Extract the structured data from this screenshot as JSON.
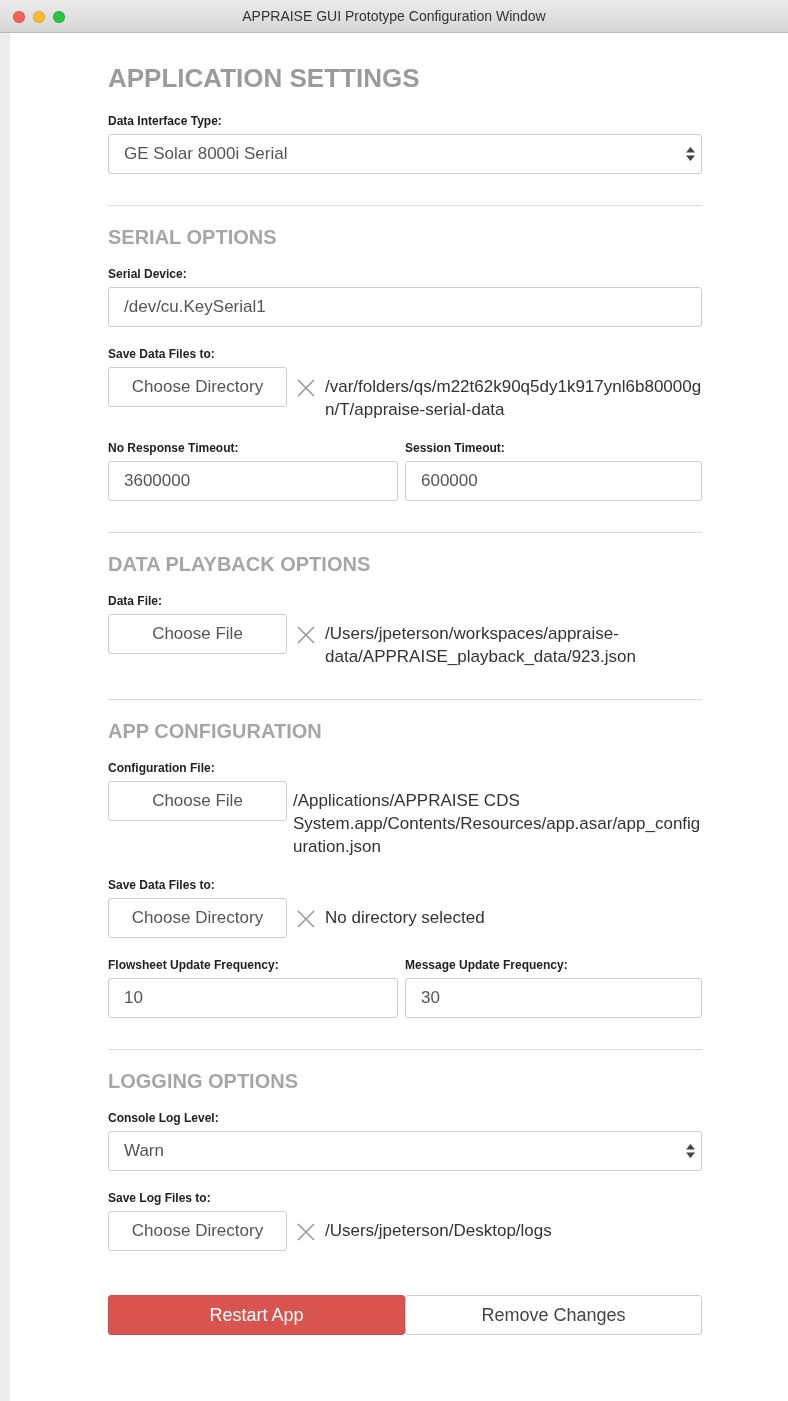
{
  "window": {
    "title": "APPRAISE GUI Prototype Configuration Window"
  },
  "heading": "APPLICATION SETTINGS",
  "sections": [
    {
      "fields": [
        {
          "kind": "select",
          "label": "Data Interface Type:",
          "value": "GE Solar 8000i Serial"
        }
      ]
    },
    {
      "title": "SERIAL OPTIONS",
      "fields": [
        {
          "kind": "text",
          "label": "Serial Device:",
          "value": "/dev/cu.KeySerial1"
        },
        {
          "kind": "file",
          "label": "Save Data Files to:",
          "button": "Choose Directory",
          "clearable": true,
          "path": "/var/folders/qs/m22t62k90q5dy1k917ynl6b80000gn/T/appraise-serial-data"
        },
        {
          "kind": "pair",
          "items": [
            {
              "label": "No Response Timeout:",
              "value": "3600000"
            },
            {
              "label": "Session Timeout:",
              "value": "600000"
            }
          ]
        }
      ]
    },
    {
      "title": "DATA PLAYBACK OPTIONS",
      "fields": [
        {
          "kind": "file",
          "label": "Data File:",
          "button": "Choose File",
          "clearable": true,
          "path": "/Users/jpeterson/workspaces/appraise-data/APPRAISE_playback_data/923.json"
        }
      ]
    },
    {
      "title": "APP CONFIGURATION",
      "fields": [
        {
          "kind": "file",
          "label": "Configuration File:",
          "button": "Choose File",
          "clearable": false,
          "path": "/Applications/APPRAISE CDS System.app/Contents/Resources/app.asar/app_configuration.json"
        },
        {
          "kind": "file",
          "label": "Save Data Files to:",
          "button": "Choose Directory",
          "clearable": true,
          "path": "No directory selected"
        },
        {
          "kind": "pair",
          "items": [
            {
              "label": "Flowsheet Update Frequency:",
              "value": "10"
            },
            {
              "label": "Message Update Frequency:",
              "value": "30"
            }
          ]
        }
      ]
    },
    {
      "title": "LOGGING OPTIONS",
      "fields": [
        {
          "kind": "select",
          "label": "Console Log Level:",
          "value": "Warn"
        },
        {
          "kind": "file",
          "label": "Save Log Files to:",
          "button": "Choose Directory",
          "clearable": true,
          "path": "/Users/jpeterson/Desktop/logs"
        }
      ]
    }
  ],
  "buttons": [
    {
      "kind": "primary",
      "label": "Restart App"
    },
    {
      "kind": "secondary",
      "label": "Remove Changes"
    }
  ]
}
